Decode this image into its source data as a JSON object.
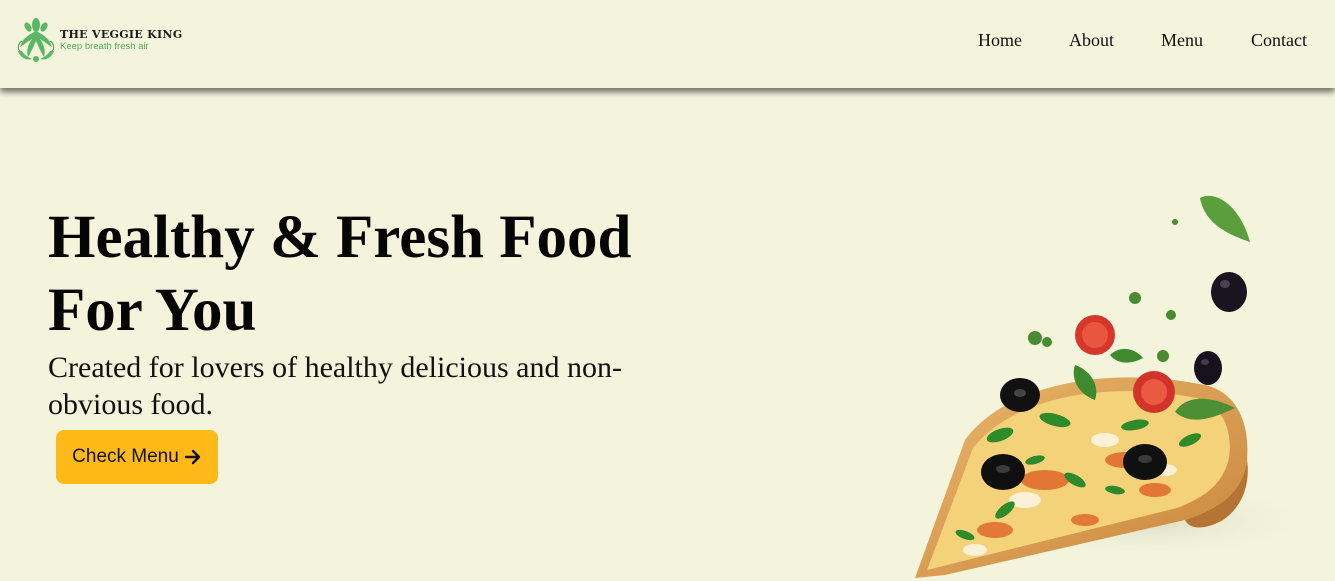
{
  "brand": {
    "name": "THE VEGGIE KING",
    "tagline": "Keep breath fresh air",
    "logo_icon": "leaf-ornament-icon",
    "logo_color": "#4fae5c"
  },
  "nav": {
    "items": [
      {
        "label": "Home"
      },
      {
        "label": "About"
      },
      {
        "label": "Menu"
      },
      {
        "label": "Contact"
      }
    ]
  },
  "hero": {
    "title": "Healthy & Fresh Food For You",
    "subtitle": "Created for lovers of healthy delicious and non-obvious food.",
    "cta_label": "Check Menu",
    "cta_icon": "arrow-right-icon",
    "cta_color": "#ffba1a",
    "image": "pizza-slice-with-flying-toppings"
  },
  "colors": {
    "background": "#f4f4dc",
    "text": "#0d0d0d"
  }
}
